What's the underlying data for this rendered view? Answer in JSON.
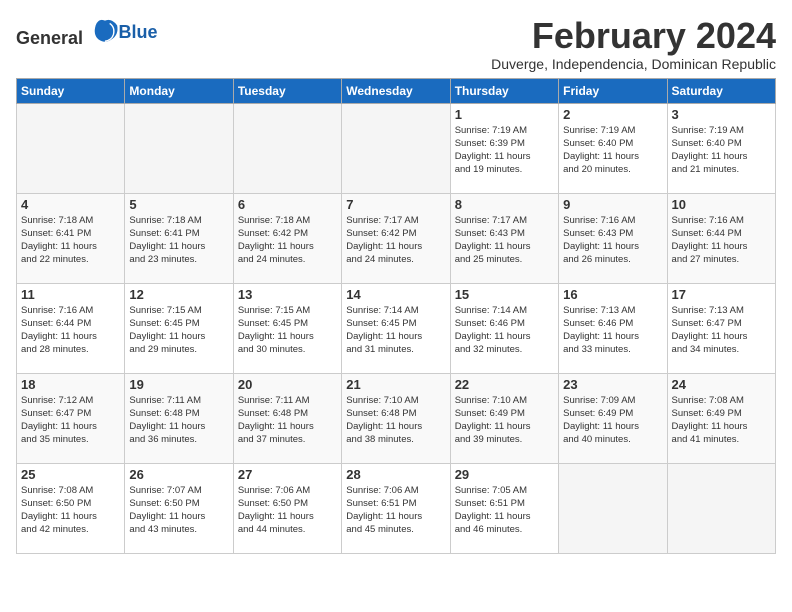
{
  "logo": {
    "general": "General",
    "blue": "Blue"
  },
  "header": {
    "month": "February 2024",
    "location": "Duverge, Independencia, Dominican Republic"
  },
  "weekdays": [
    "Sunday",
    "Monday",
    "Tuesday",
    "Wednesday",
    "Thursday",
    "Friday",
    "Saturday"
  ],
  "weeks": [
    [
      {
        "day": "",
        "info": ""
      },
      {
        "day": "",
        "info": ""
      },
      {
        "day": "",
        "info": ""
      },
      {
        "day": "",
        "info": ""
      },
      {
        "day": "1",
        "info": "Sunrise: 7:19 AM\nSunset: 6:39 PM\nDaylight: 11 hours\nand 19 minutes."
      },
      {
        "day": "2",
        "info": "Sunrise: 7:19 AM\nSunset: 6:40 PM\nDaylight: 11 hours\nand 20 minutes."
      },
      {
        "day": "3",
        "info": "Sunrise: 7:19 AM\nSunset: 6:40 PM\nDaylight: 11 hours\nand 21 minutes."
      }
    ],
    [
      {
        "day": "4",
        "info": "Sunrise: 7:18 AM\nSunset: 6:41 PM\nDaylight: 11 hours\nand 22 minutes."
      },
      {
        "day": "5",
        "info": "Sunrise: 7:18 AM\nSunset: 6:41 PM\nDaylight: 11 hours\nand 23 minutes."
      },
      {
        "day": "6",
        "info": "Sunrise: 7:18 AM\nSunset: 6:42 PM\nDaylight: 11 hours\nand 24 minutes."
      },
      {
        "day": "7",
        "info": "Sunrise: 7:17 AM\nSunset: 6:42 PM\nDaylight: 11 hours\nand 24 minutes."
      },
      {
        "day": "8",
        "info": "Sunrise: 7:17 AM\nSunset: 6:43 PM\nDaylight: 11 hours\nand 25 minutes."
      },
      {
        "day": "9",
        "info": "Sunrise: 7:16 AM\nSunset: 6:43 PM\nDaylight: 11 hours\nand 26 minutes."
      },
      {
        "day": "10",
        "info": "Sunrise: 7:16 AM\nSunset: 6:44 PM\nDaylight: 11 hours\nand 27 minutes."
      }
    ],
    [
      {
        "day": "11",
        "info": "Sunrise: 7:16 AM\nSunset: 6:44 PM\nDaylight: 11 hours\nand 28 minutes."
      },
      {
        "day": "12",
        "info": "Sunrise: 7:15 AM\nSunset: 6:45 PM\nDaylight: 11 hours\nand 29 minutes."
      },
      {
        "day": "13",
        "info": "Sunrise: 7:15 AM\nSunset: 6:45 PM\nDaylight: 11 hours\nand 30 minutes."
      },
      {
        "day": "14",
        "info": "Sunrise: 7:14 AM\nSunset: 6:45 PM\nDaylight: 11 hours\nand 31 minutes."
      },
      {
        "day": "15",
        "info": "Sunrise: 7:14 AM\nSunset: 6:46 PM\nDaylight: 11 hours\nand 32 minutes."
      },
      {
        "day": "16",
        "info": "Sunrise: 7:13 AM\nSunset: 6:46 PM\nDaylight: 11 hours\nand 33 minutes."
      },
      {
        "day": "17",
        "info": "Sunrise: 7:13 AM\nSunset: 6:47 PM\nDaylight: 11 hours\nand 34 minutes."
      }
    ],
    [
      {
        "day": "18",
        "info": "Sunrise: 7:12 AM\nSunset: 6:47 PM\nDaylight: 11 hours\nand 35 minutes."
      },
      {
        "day": "19",
        "info": "Sunrise: 7:11 AM\nSunset: 6:48 PM\nDaylight: 11 hours\nand 36 minutes."
      },
      {
        "day": "20",
        "info": "Sunrise: 7:11 AM\nSunset: 6:48 PM\nDaylight: 11 hours\nand 37 minutes."
      },
      {
        "day": "21",
        "info": "Sunrise: 7:10 AM\nSunset: 6:48 PM\nDaylight: 11 hours\nand 38 minutes."
      },
      {
        "day": "22",
        "info": "Sunrise: 7:10 AM\nSunset: 6:49 PM\nDaylight: 11 hours\nand 39 minutes."
      },
      {
        "day": "23",
        "info": "Sunrise: 7:09 AM\nSunset: 6:49 PM\nDaylight: 11 hours\nand 40 minutes."
      },
      {
        "day": "24",
        "info": "Sunrise: 7:08 AM\nSunset: 6:49 PM\nDaylight: 11 hours\nand 41 minutes."
      }
    ],
    [
      {
        "day": "25",
        "info": "Sunrise: 7:08 AM\nSunset: 6:50 PM\nDaylight: 11 hours\nand 42 minutes."
      },
      {
        "day": "26",
        "info": "Sunrise: 7:07 AM\nSunset: 6:50 PM\nDaylight: 11 hours\nand 43 minutes."
      },
      {
        "day": "27",
        "info": "Sunrise: 7:06 AM\nSunset: 6:50 PM\nDaylight: 11 hours\nand 44 minutes."
      },
      {
        "day": "28",
        "info": "Sunrise: 7:06 AM\nSunset: 6:51 PM\nDaylight: 11 hours\nand 45 minutes."
      },
      {
        "day": "29",
        "info": "Sunrise: 7:05 AM\nSunset: 6:51 PM\nDaylight: 11 hours\nand 46 minutes."
      },
      {
        "day": "",
        "info": ""
      },
      {
        "day": "",
        "info": ""
      }
    ]
  ]
}
